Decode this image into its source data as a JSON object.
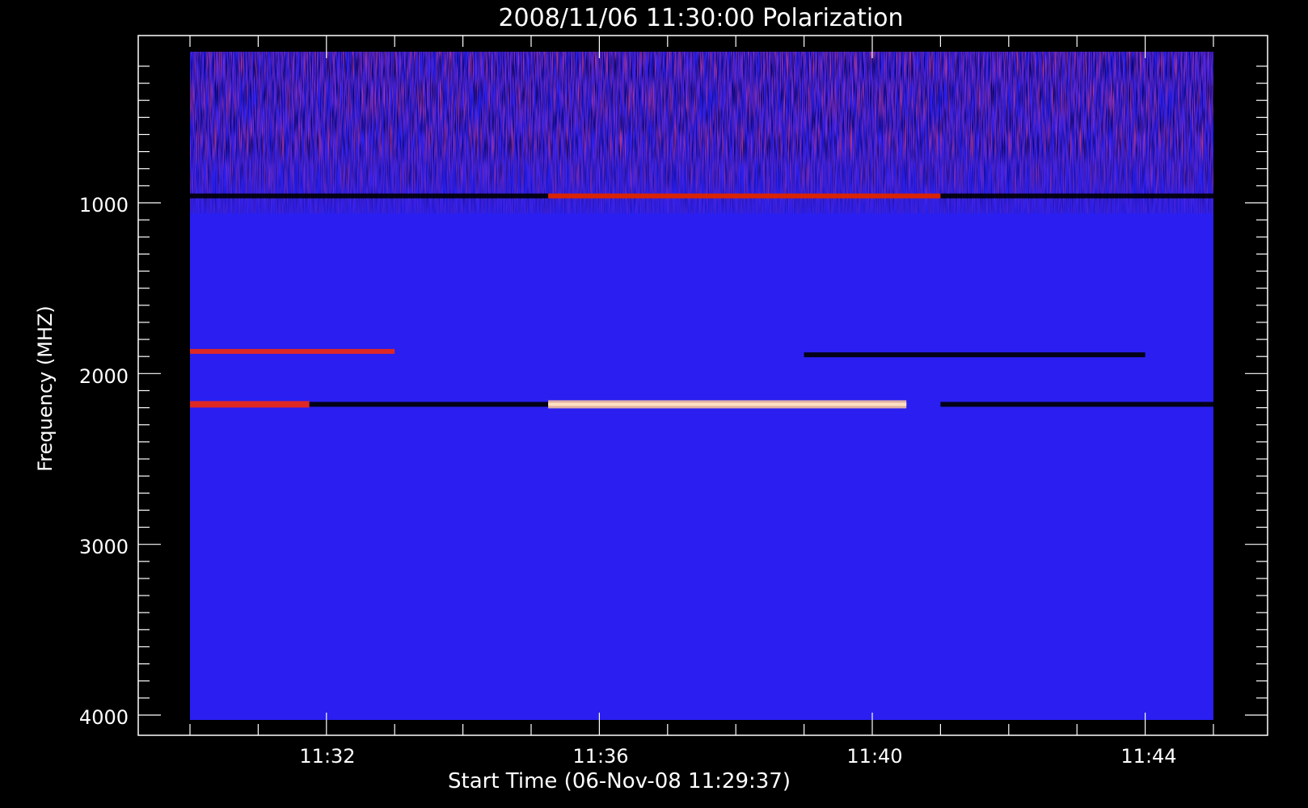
{
  "chart_data": {
    "type": "heatmap",
    "title": "2008/11/06 11:30:00 Polarization",
    "xlabel": "Start Time (06-Nov-08 11:29:37)",
    "ylabel": "Frequency (MHZ)",
    "xlim": [
      "11:29:37",
      "11:45:46"
    ],
    "ylim": [
      4000,
      120
    ],
    "x_tick_labels": [
      "11:32",
      "11:36",
      "11:40",
      "11:44"
    ],
    "y_tick_labels": [
      "1000",
      "2000",
      "3000",
      "4000"
    ],
    "data_extent": {
      "time_start": "11:30:00",
      "time_end": "11:45:00",
      "freq_low_mhz": 4020,
      "freq_high_mhz": 110
    },
    "colormap": {
      "background": "#2a1ff0",
      "low": "#000000",
      "high": "#ff2a00",
      "peak": "#ffcc99"
    },
    "features": [
      {
        "name": "dark band",
        "freq_mhz": 960,
        "time_start": "11:30:00",
        "time_end": "11:45:00",
        "polarity": "low"
      },
      {
        "name": "red band",
        "freq_mhz": 960,
        "time_start": "11:35:15",
        "time_end": "11:41:00",
        "polarity": "high"
      },
      {
        "name": "red band",
        "freq_mhz": 1870,
        "time_start": "11:30:00",
        "time_end": "11:33:00",
        "polarity": "high"
      },
      {
        "name": "dark band",
        "freq_mhz": 1890,
        "time_start": "11:39:00",
        "time_end": "11:44:00",
        "polarity": "low"
      },
      {
        "name": "strong red band",
        "freq_mhz": 2180,
        "time_start": "11:30:00",
        "time_end": "11:31:45",
        "polarity": "high"
      },
      {
        "name": "dark band",
        "freq_mhz": 2180,
        "time_start": "11:31:45",
        "time_end": "11:35:15",
        "polarity": "low"
      },
      {
        "name": "bright red band",
        "freq_mhz": 2180,
        "time_start": "11:35:15",
        "time_end": "11:40:30",
        "polarity": "peak"
      },
      {
        "name": "dark band",
        "freq_mhz": 2180,
        "time_start": "11:41:00",
        "time_end": "11:45:00",
        "polarity": "low"
      }
    ]
  }
}
